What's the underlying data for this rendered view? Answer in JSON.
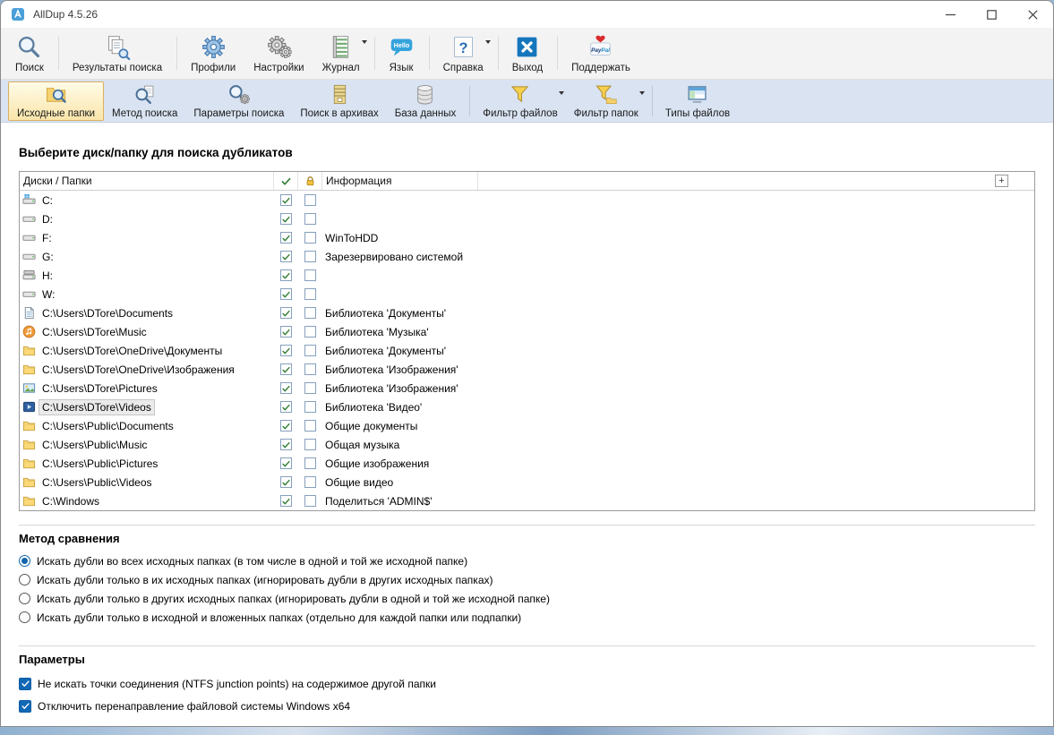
{
  "window": {
    "title": "AllDup 4.5.26"
  },
  "toolbar_main": {
    "items": [
      {
        "label": "Поиск",
        "icon": "search-icon",
        "sep_after": true
      },
      {
        "label": "Результаты поиска",
        "icon": "search-results-icon",
        "sep_after": true
      },
      {
        "label": "Профили",
        "icon": "profiles-icon"
      },
      {
        "label": "Настройки",
        "icon": "settings-icon"
      },
      {
        "label": "Журнал",
        "icon": "journal-icon",
        "dropdown": true,
        "sep_after": true
      },
      {
        "label": "Язык",
        "icon": "language-icon",
        "sep_after": true
      },
      {
        "label": "Справка",
        "icon": "help-icon",
        "dropdown": true,
        "sep_after": true
      },
      {
        "label": "Выход",
        "icon": "exit-icon",
        "sep_after": true
      },
      {
        "label": "Поддержать",
        "icon": "paypal-icon"
      }
    ]
  },
  "toolbar_search": {
    "items": [
      {
        "label": "Исходные папки",
        "icon": "source-folders-icon",
        "active": true
      },
      {
        "label": "Метод поиска",
        "icon": "search-method-icon"
      },
      {
        "label": "Параметры поиска",
        "icon": "search-parameters-icon"
      },
      {
        "label": "Поиск в архивах",
        "icon": "archive-search-icon"
      },
      {
        "label": "База данных",
        "icon": "database-icon",
        "sep_after": true
      },
      {
        "label": "Фильтр файлов",
        "icon": "file-filter-icon",
        "dropdown": true
      },
      {
        "label": "Фильтр папок",
        "icon": "folder-filter-icon",
        "dropdown": true,
        "sep_after": true
      },
      {
        "label": "Типы файлов",
        "icon": "file-types-icon"
      }
    ]
  },
  "main": {
    "heading": "Выберите диск/папку для поиска дубликатов",
    "table": {
      "columns": {
        "folders": "Диски / Папки",
        "info": "Информация"
      },
      "expand_button": "+",
      "rows": [
        {
          "icon": "drive-c-icon",
          "path": "C:",
          "checked": true,
          "locked": false,
          "selected": false,
          "info": ""
        },
        {
          "icon": "drive-icon",
          "path": "D:",
          "checked": true,
          "locked": false,
          "selected": false,
          "info": ""
        },
        {
          "icon": "drive-icon",
          "path": "F:",
          "checked": true,
          "locked": false,
          "selected": false,
          "info": "WinToHDD"
        },
        {
          "icon": "drive-icon",
          "path": "G:",
          "checked": true,
          "locked": false,
          "selected": false,
          "info": "Зарезервировано системой"
        },
        {
          "icon": "drive-h-icon",
          "path": "H:",
          "checked": true,
          "locked": false,
          "selected": false,
          "info": ""
        },
        {
          "icon": "drive-icon",
          "path": "W:",
          "checked": true,
          "locked": false,
          "selected": false,
          "info": ""
        },
        {
          "icon": "document-library-icon",
          "path": "C:\\Users\\DTore\\Documents",
          "checked": true,
          "locked": false,
          "selected": false,
          "info": "Библиотека 'Документы'"
        },
        {
          "icon": "music-icon",
          "path": "C:\\Users\\DTore\\Music",
          "checked": true,
          "locked": false,
          "selected": false,
          "info": "Библиотека 'Музыка'"
        },
        {
          "icon": "folder-icon",
          "path": "C:\\Users\\DTore\\OneDrive\\Документы",
          "checked": true,
          "locked": false,
          "selected": false,
          "info": "Библиотека 'Документы'"
        },
        {
          "icon": "folder-icon",
          "path": "C:\\Users\\DTore\\OneDrive\\Изображения",
          "checked": true,
          "locked": false,
          "selected": false,
          "info": "Библиотека 'Изображения'"
        },
        {
          "icon": "picture-library-icon",
          "path": "C:\\Users\\DTore\\Pictures",
          "checked": true,
          "locked": false,
          "selected": false,
          "info": "Библиотека 'Изображения'"
        },
        {
          "icon": "video-library-icon",
          "path": "C:\\Users\\DTore\\Videos",
          "checked": true,
          "locked": false,
          "selected": true,
          "info": "Библиотека 'Видео'"
        },
        {
          "icon": "folder-icon",
          "path": "C:\\Users\\Public\\Documents",
          "checked": true,
          "locked": false,
          "selected": false,
          "info": "Общие документы"
        },
        {
          "icon": "folder-icon",
          "path": "C:\\Users\\Public\\Music",
          "checked": true,
          "locked": false,
          "selected": false,
          "info": "Общая музыка"
        },
        {
          "icon": "folder-icon",
          "path": "C:\\Users\\Public\\Pictures",
          "checked": true,
          "locked": false,
          "selected": false,
          "info": "Общие изображения"
        },
        {
          "icon": "folder-icon",
          "path": "C:\\Users\\Public\\Videos",
          "checked": true,
          "locked": false,
          "selected": false,
          "info": "Общие видео"
        },
        {
          "icon": "folder-icon",
          "path": "C:\\Windows",
          "checked": true,
          "locked": false,
          "selected": false,
          "info": "Поделиться 'ADMIN$'"
        }
      ]
    },
    "compare_method": {
      "heading": "Метод сравнения",
      "options": [
        {
          "label": "Искать дубли во всех исходных папках (в том числе в одной и той же исходной папке)",
          "selected": true
        },
        {
          "label": "Искать дубли только в их исходных папках (игнорировать дубли в других исходных папках)",
          "selected": false
        },
        {
          "label": "Искать дубли только в других исходных папках (игнорировать дубли в одной и той же исходной папке)",
          "selected": false
        },
        {
          "label": "Искать дубли только в исходной и вложенных папках (отдельно для каждой папки или подпапки)",
          "selected": false
        }
      ]
    },
    "parameters": {
      "heading": "Параметры",
      "options": [
        {
          "label": "Не искать точки соединения (NTFS junction points) на содержимое другой папки",
          "checked": true
        },
        {
          "label": "Отключить перенаправление файловой системы Windows x64",
          "checked": true
        }
      ]
    }
  }
}
